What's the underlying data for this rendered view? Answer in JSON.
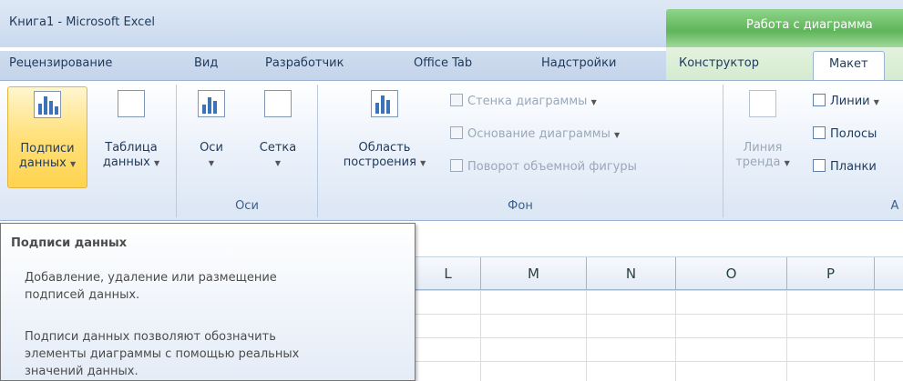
{
  "window": {
    "title": "Книга1  -  Microsoft Excel"
  },
  "context_tab_header": "Работа с диаграмма",
  "tabs": [
    "Рецензирование",
    "Вид",
    "Разработчик",
    "Office Tab",
    "Надстройки",
    "Конструктор",
    "Макет"
  ],
  "active_tab": "Макет",
  "ribbon": {
    "labels_group": {
      "data_labels": {
        "line1": "Подписи",
        "line2": "данных"
      },
      "data_table": {
        "line1": "Таблица",
        "line2": "данных"
      }
    },
    "axes_group": {
      "label": "Оси",
      "axes": "Оси",
      "gridlines": "Сетка"
    },
    "background_group": {
      "label": "Фон",
      "plot_area": {
        "line1": "Область",
        "line2": "построения"
      },
      "chart_wall": "Стенка диаграммы",
      "chart_floor": "Основание диаграммы",
      "rotation_3d": "Поворот объемной фигуры"
    },
    "analysis_group": {
      "label": "А",
      "trendline": {
        "line1": "Линия",
        "line2": "тренда"
      },
      "lines": "Линии",
      "updown_bars": "Полосы",
      "error_bars": "Планки"
    }
  },
  "columns": [
    "L",
    "M",
    "N",
    "O",
    "P"
  ],
  "tooltip": {
    "title": "Подписи данных",
    "para1": [
      "Добавление, удаление или размещение",
      "подписей данных."
    ],
    "para2": [
      "Подписи данных позволяют обозначить",
      "элементы диаграммы с помощью реальных",
      "значений данных."
    ]
  }
}
